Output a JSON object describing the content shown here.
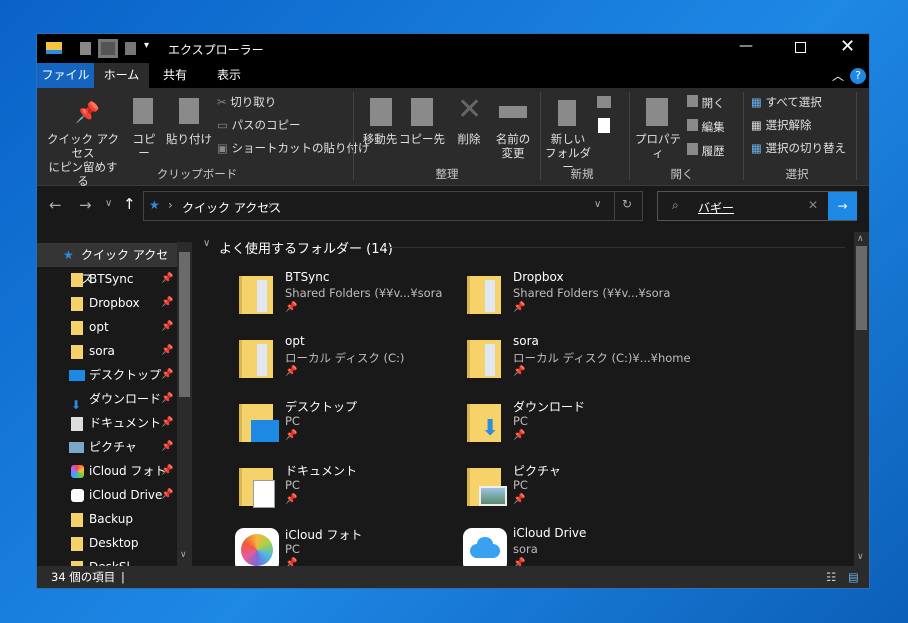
{
  "window": {
    "title": "エクスプローラー"
  },
  "tabs": [
    {
      "label": "ファイル"
    },
    {
      "label": "ホーム"
    },
    {
      "label": "共有"
    },
    {
      "label": "表示"
    }
  ],
  "ribbon": {
    "clipboard": {
      "pin": "クイック アクセス",
      "pin2": "にピン留めする",
      "copy": "コピー",
      "paste": "貼り付け",
      "cut": "切り取り",
      "copy_path": "パスのコピー",
      "paste_shortcut": "ショートカットの貼り付け",
      "group": "クリップボード"
    },
    "organize": {
      "move": "移動先",
      "copy_to": "コピー先",
      "delete": "削除",
      "rename": "名前の",
      "rename2": "変更",
      "group": "整理"
    },
    "new": {
      "new_folder": "新しい",
      "new_folder2": "フォルダー",
      "group": "新規"
    },
    "open": {
      "properties": "プロパティ",
      "open": "開く",
      "edit": "編集",
      "history": "履歴",
      "group": "開く"
    },
    "select": {
      "select_all": "すべて選択",
      "select_none": "選択解除",
      "invert": "選択の切り替え",
      "group": "選択"
    }
  },
  "address": {
    "path": "クイック アクセス"
  },
  "search": {
    "value": "バギー"
  },
  "sidebar": {
    "header": "クイック アクセス",
    "items": [
      {
        "label": "BTSync",
        "pinned": true
      },
      {
        "label": "Dropbox",
        "pinned": true
      },
      {
        "label": "opt",
        "pinned": true
      },
      {
        "label": "sora",
        "pinned": true
      },
      {
        "label": "デスクトップ",
        "pinned": true
      },
      {
        "label": "ダウンロード",
        "pinned": true
      },
      {
        "label": "ドキュメント",
        "pinned": true
      },
      {
        "label": "ピクチャ",
        "pinned": true
      },
      {
        "label": "iCloud フォト",
        "pinned": true
      },
      {
        "label": "iCloud Drive",
        "pinned": true
      },
      {
        "label": "Backup",
        "pinned": false
      },
      {
        "label": "Desktop",
        "pinned": false
      },
      {
        "label": "DeskSl...",
        "pinned": false
      }
    ]
  },
  "content": {
    "section": "よく使用するフォルダー (14)",
    "items": [
      {
        "name": "BTSync",
        "location": "Shared Folders (¥¥v...¥sora"
      },
      {
        "name": "Dropbox",
        "location": "Shared Folders (¥¥v...¥sora"
      },
      {
        "name": "opt",
        "location": "ローカル ディスク (C:)"
      },
      {
        "name": "sora",
        "location": "ローカル ディスク (C:)¥...¥home"
      },
      {
        "name": "デスクトップ",
        "location": "PC"
      },
      {
        "name": "ダウンロード",
        "location": "PC"
      },
      {
        "name": "ドキュメント",
        "location": "PC"
      },
      {
        "name": "ピクチャ",
        "location": "PC"
      },
      {
        "name": "iCloud フォト",
        "location": "PC"
      },
      {
        "name": "iCloud Drive",
        "location": "sora"
      }
    ]
  },
  "status": {
    "count": "34 個の項目"
  },
  "colors": {
    "accent": "#0a64c8",
    "folder": "#f5d36a"
  }
}
